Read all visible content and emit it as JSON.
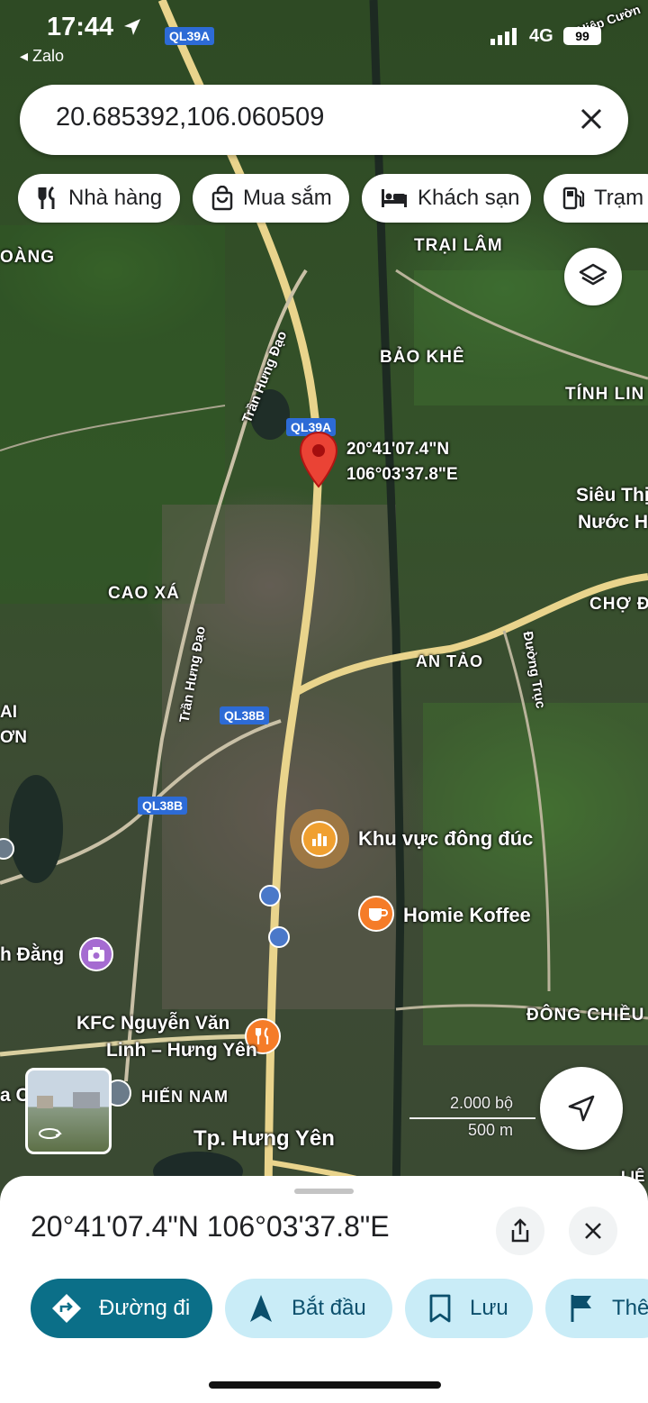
{
  "status_bar": {
    "time": "17:44",
    "back_app": "◂ Zalo",
    "network": "4G",
    "battery": "99"
  },
  "search": {
    "query": "20.685392,106.060509"
  },
  "categories": [
    {
      "label": "Nhà hàng",
      "icon": "restaurant-icon"
    },
    {
      "label": "Mua sắm",
      "icon": "shopping-bag-icon"
    },
    {
      "label": "Khách sạn",
      "icon": "bed-icon"
    },
    {
      "label": "Trạm",
      "icon": "gas-station-icon"
    }
  ],
  "map": {
    "road_badges": [
      "QL39A",
      "QL39A",
      "QL38B",
      "QL38B"
    ],
    "place_labels": {
      "trai_lam": "TRẠI LÂM",
      "bao_khe": "BẢO KHÊ",
      "tinh_lin": "TÍNH LIN",
      "oang": "OÀNG",
      "cao_xa": "CAO XÁ",
      "an_tao": "AN TẢO",
      "cho": "CHỢ Đ",
      "dong_chieu": "ĐÔNG CHIỀU",
      "hien_nam": "HIẾN NAM",
      "tp_hung_yen": "Tp. Hưng Yên",
      "ai": "AI",
      "on": "ƠN",
      "lie": "LIÊ",
      "hiep_cuong": "Hiệp Cườn"
    },
    "street_labels": {
      "tran_hung_dao_1": "Trần Hưng Đạo",
      "tran_hung_dao_2": "Trần Hưng Đạo",
      "duong_truc": "Đường Trục"
    },
    "pin_coordinates": {
      "lat": "20°41'07.4\"N",
      "lng": "106°03'37.8\"E"
    },
    "pois": {
      "busy_area": "Khu vực đông đúc",
      "homie": "Homie Koffee",
      "kfc_line1": "KFC Nguyễn Văn",
      "kfc_line2": "Linh – Hưng Yên",
      "sieu_thi_1": "Siêu Thị",
      "sieu_thi_2": "Nước HUY",
      "h_dang": "h Đằng",
      "a_c": "a C"
    },
    "scale": {
      "imperial": "2.000 bộ",
      "metric": "500 m"
    }
  },
  "sheet": {
    "coordinates": "20°41'07.4\"N 106°03'37.8\"E",
    "actions": [
      {
        "label": "Đường đi",
        "icon": "directions-icon"
      },
      {
        "label": "Bắt đầu",
        "icon": "navigation-arrow-icon"
      },
      {
        "label": "Lưu",
        "icon": "bookmark-icon"
      },
      {
        "label": "Thê",
        "icon": "flag-icon"
      }
    ]
  }
}
